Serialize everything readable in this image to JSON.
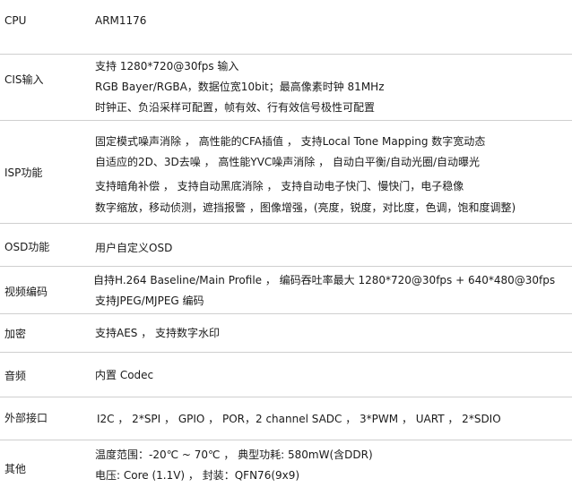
{
  "rows": [
    {
      "label": "CPU",
      "lines": [
        "ARM1176"
      ]
    },
    {
      "label": "CIS输入",
      "lines": [
        "支持 1280*720@30fps 输入",
        "RGB Bayer/RGBA，数据位宽10bit；最高像素时钟 81MHz",
        "时钟正、负沿采样可配置，帧有效、行有效信号极性可配置"
      ]
    },
    {
      "label": "ISP功能",
      "lines": [
        "固定模式噪声消除 ， 高性能的CFA插值 ， 支持Local Tone Mapping 数字宽动态",
        "自适应的2D、3D去噪 ， 高性能YVC噪声消除 ， 自动白平衡/自动光圈/自动曝光",
        "支持暗角补偿 ， 支持自动黑底消除 ， 支持自动电子快门、慢快门，电子稳像",
        "数字缩放，移动侦测，遮挡报警 ，图像增强，(亮度，锐度，对比度，色调，饱和度调整)"
      ]
    },
    {
      "label": "OSD功能",
      "lines": [
        "用户自定义OSD"
      ]
    },
    {
      "label": "视频编码",
      "lines": [
        "自持H.264  Baseline/Main Profile ， 编码吞吐率最大 1280*720@30fps + 640*480@30fps",
        "支持JPEG/MJPEG 编码"
      ]
    },
    {
      "label": "加密",
      "lines": [
        "支持AES ， 支持数字水印"
      ]
    },
    {
      "label": "音频",
      "lines": [
        "内置 Codec"
      ]
    },
    {
      "label": "外部接口",
      "lines": [
        "I2C ， 2*SPI ， GPIO ， POR，2 channel SADC ， 3*PWM ， UART ， 2*SDIO"
      ]
    },
    {
      "label": "其他",
      "lines": [
        "温度范围：-20℃ ~ 70℃ ， 典型功耗: 580mW(含DDR)",
        "电压: Core (1.1V) ， 封装：QFN76(9x9)"
      ]
    }
  ]
}
